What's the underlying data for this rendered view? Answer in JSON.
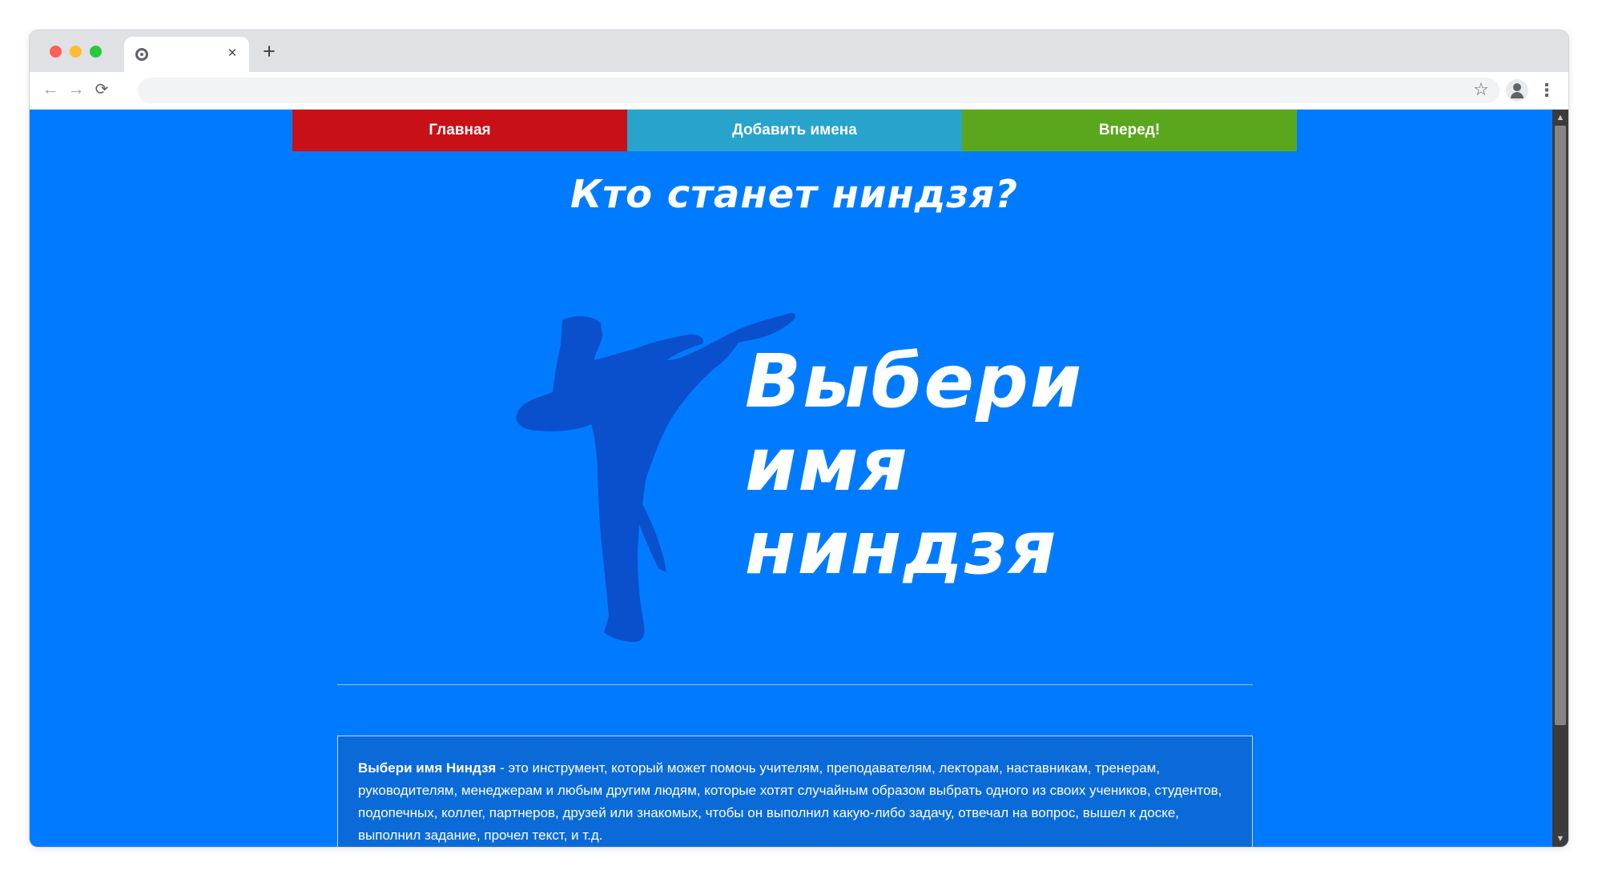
{
  "browser": {
    "tab": {
      "close_glyph": "×"
    },
    "new_tab_glyph": "+",
    "toolbar": {
      "back_glyph": "←",
      "forward_glyph": "→",
      "reload_glyph": "⟳",
      "star_glyph": "☆",
      "menu_glyph": "⋮"
    }
  },
  "nav": {
    "home": "Главная",
    "add_names": "Добавить имена",
    "forward": "Вперед!"
  },
  "page": {
    "title": "Кто станет ниндзя?",
    "logo_lines": [
      "Выбери",
      "имя",
      "ниндзя"
    ],
    "description_bold": "Выбери имя Ниндзя",
    "description_text": " - это инструмент, который может помочь учителям, преподавателям, лекторам, наставникам, тренерам, руководителям, менеджерам и любым другим людям, которые хотят случайным образом выбрать одного из своих учеников, студентов, подопечных, коллег, партнеров, друзей или знакомых, чтобы он выполнил какую-либо задачу, отвечал на вопрос, вышел к доске, выполнил задание, прочел текст, и т.д."
  },
  "colors": {
    "page_background": "#007bff",
    "nav_home": "#c81017",
    "nav_add": "#27a3cc",
    "nav_forward": "#5aa71e",
    "ninja_silhouette": "#0a4fcc"
  },
  "icons": {
    "tab_favicon": "chrome-icon",
    "ninja": "ninja-kick-icon"
  }
}
